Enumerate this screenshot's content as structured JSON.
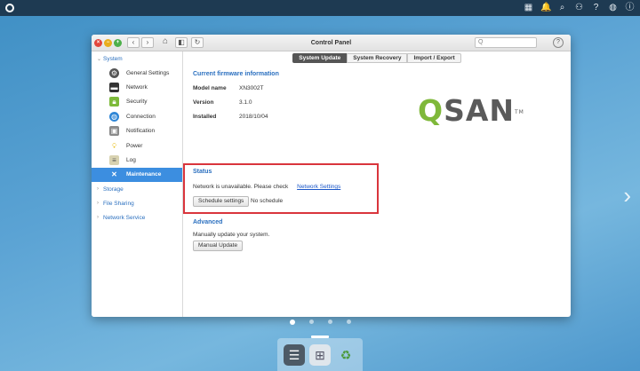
{
  "desktop": {
    "topbar_icons": [
      "qsan-logo-icon",
      "grid-icon",
      "bell-icon",
      "search-icon",
      "user-icon",
      "help-icon",
      "globe-icon",
      "info-icon"
    ],
    "next_arrow": "›",
    "pages": 4,
    "current_page": 1
  },
  "window": {
    "title": "Control Panel",
    "search_placeholder": "Q",
    "help_label": "?",
    "nav_back": "‹",
    "nav_forward": "›",
    "home_glyph": "⌂",
    "panel_glyph": "◧",
    "refresh_glyph": "↻"
  },
  "sidebar": {
    "groups": [
      {
        "label": "System",
        "expanded": true
      },
      {
        "label": "Storage"
      },
      {
        "label": "File Sharing"
      },
      {
        "label": "Network Service"
      }
    ],
    "items": [
      {
        "label": "General Settings",
        "icon": "gear-icon"
      },
      {
        "label": "Network",
        "icon": "network-icon"
      },
      {
        "label": "Security",
        "icon": "lock-icon"
      },
      {
        "label": "Connection",
        "icon": "globe-icon"
      },
      {
        "label": "Notification",
        "icon": "notification-icon"
      },
      {
        "label": "Power",
        "icon": "bulb-icon"
      },
      {
        "label": "Log",
        "icon": "log-icon"
      },
      {
        "label": "Maintenance",
        "icon": "wrench-icon",
        "active": true
      }
    ]
  },
  "tabs": [
    "System Update",
    "System Recovery",
    "Import / Export"
  ],
  "firmware": {
    "title": "Current firmware information",
    "model_label": "Model name",
    "model_value": "XN3002T",
    "version_label": "Version",
    "version_value": "3.1.0",
    "installed_label": "Installed",
    "installed_value": "2018/10/04"
  },
  "brand": {
    "logo_text": "SAN",
    "tm": "TM",
    "accent": "#7fb83a"
  },
  "status": {
    "title": "Status",
    "message": "Network is unavailable. Please check",
    "link": "Network Settings",
    "schedule_button": "Schedule settings",
    "schedule_value": "No schedule"
  },
  "advanced": {
    "title": "Advanced",
    "description": "Manually update your system.",
    "button": "Manual Update"
  }
}
